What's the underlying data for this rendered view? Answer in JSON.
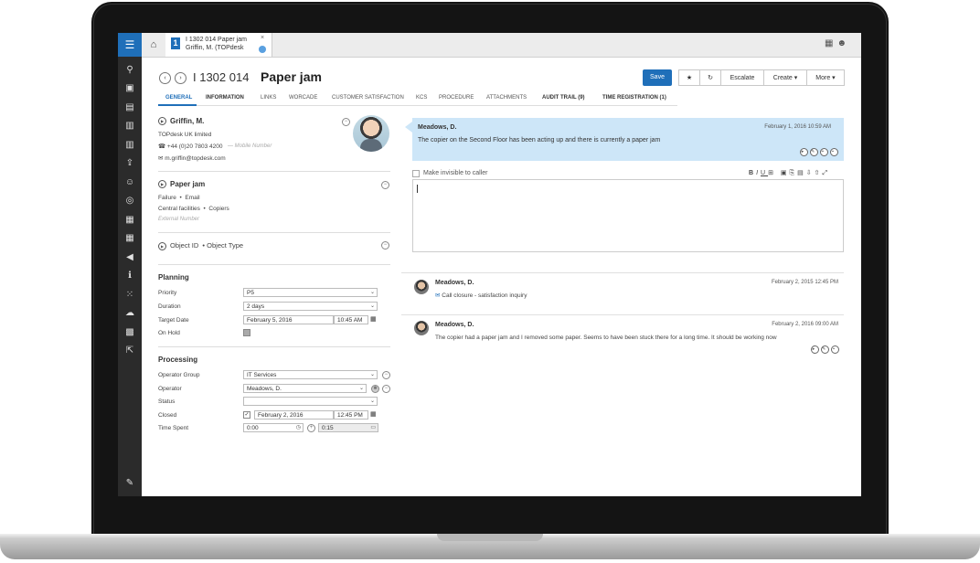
{
  "tab": {
    "line1": "I 1302 014 Paper jam",
    "line2": "Griffin, M. (TOPdesk",
    "close": "×"
  },
  "header": {
    "number": "I 1302 014",
    "title": "Paper jam"
  },
  "toolbar": {
    "save": "Save",
    "escalate": "Escalate",
    "create": "Create ▾",
    "more": "More ▾"
  },
  "tabs": [
    "GENERAL",
    "INFORMATION",
    "LINKS",
    "WORCADE",
    "CUSTOMER SATISFACTION",
    "KCS",
    "PROCEDURE",
    "ATTACHMENTS",
    "AUDIT TRAIL (9)",
    "TIME REGISTRATION (1)"
  ],
  "caller": {
    "name": "Griffin, M.",
    "company": "TOPdesk UK limited",
    "phone": "+44 (0)20 7803 4200",
    "mobile_placeholder": "Mobile Number",
    "email": "m.griffin@topdesk.com"
  },
  "request": {
    "title": "Paper jam",
    "category": "Failure",
    "channel": "Email",
    "subcategory": "Central facilities",
    "subsub": "Copiers",
    "external": "External Number"
  },
  "object": {
    "id": "Object ID",
    "type": "Object Type"
  },
  "planning": {
    "title": "Planning",
    "priority_label": "Priority",
    "priority": "P5",
    "duration_label": "Duration",
    "duration": "2 days",
    "target_label": "Target Date",
    "target_date": "February 5, 2016",
    "target_time": "10:45 AM",
    "onhold_label": "On Hold"
  },
  "processing": {
    "title": "Processing",
    "group_label": "Operator Group",
    "group": "IT Services",
    "operator_label": "Operator",
    "operator": "Meadows, D.",
    "status_label": "Status",
    "status": "",
    "closed_label": "Closed",
    "closed_date": "February 2, 2016",
    "closed_time": "12:45 PM",
    "time_label": "Time Spent",
    "time": "0:00",
    "time2": "0:15"
  },
  "conversation": {
    "first": {
      "author": "Meadows, D.",
      "date": "February 1, 2016 10:59 AM",
      "text": "The copier on the Second Floor has been acting up and there is currently a paper jam"
    },
    "invisible_label": "Make invisible to caller",
    "entries": [
      {
        "author": "Meadows, D.",
        "date": "February 2, 2015 12:45 PM",
        "text": "Call closure - satisfaction inquiry"
      },
      {
        "author": "Meadows, D.",
        "date": "February 2, 2016 09:00 AM",
        "text": "The copier had a paper jam and I removed some paper. Seems to have been stuck there for a long time. It should be working now"
      }
    ]
  },
  "colors": {
    "accent": "#1f6fb9",
    "bubble": "#cde6f8",
    "nav": "#2b2b2b"
  }
}
